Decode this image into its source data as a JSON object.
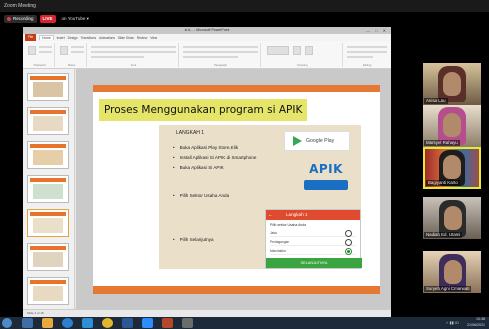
{
  "zoom": {
    "window_title": "Zoom Meeting",
    "recording_label": "Recording",
    "live_label": "LIVE",
    "stream_target": "on YouTube ▾"
  },
  "powerpoint": {
    "window_title": "si A... - Microsoft PowerPoint",
    "file_tab": "File",
    "tabs": [
      "Home",
      "Insert",
      "Design",
      "Transitions",
      "Animations",
      "Slide Show",
      "Review",
      "View"
    ],
    "ribbon_groups": [
      "Clipboard",
      "Slides",
      "Font",
      "Paragraph",
      "Drawing",
      "Editing"
    ],
    "status_bar": "Slide 4 of 15"
  },
  "slide": {
    "title": "Proses Menggunakan program si APIK",
    "step_heading": "LANGKAH 1",
    "steps": [
      "Buka Aplikasi Play Store,Klik",
      "Install Aplikasi Si APIK di Smartphone",
      "Buka Aplikasi Si APIK"
    ],
    "bullet_sector": "Pilih Sektor Usaha Anda",
    "bullet_next": "Pilih Selanjutnya",
    "google_play_label": "Google Play",
    "apik_logo_text": "APIK",
    "phone": {
      "back_arrow": "←",
      "header": "Langkah 1",
      "question": "Pilih sektor Usaha Anda",
      "options": [
        "Jasa",
        "Perdagangan",
        "Manufaktur"
      ],
      "selected_option": "Manufaktur",
      "button": "SELANJUTNYA"
    }
  },
  "participants": [
    {
      "name": "Anisa Lau"
    },
    {
      "name": "Marsyel Rahayu"
    },
    {
      "name": "Bagiyanti Karto"
    },
    {
      "name": "Nadiah Ed. Utami"
    },
    {
      "name": "Suryeh Agni Cmarwati"
    }
  ],
  "taskbar": {
    "start_icon": "windows-logo",
    "tray": "˄  ▮▮  ID",
    "time": "10:38",
    "date": "21/06/2021"
  },
  "colors": {
    "slide_accent": "#e57833",
    "title_highlight": "#e5e56a",
    "phone_header": "#e04a2f",
    "phone_button": "#3aa540",
    "live_badge": "#d6232f",
    "speaking_border": "#e3ec33"
  }
}
